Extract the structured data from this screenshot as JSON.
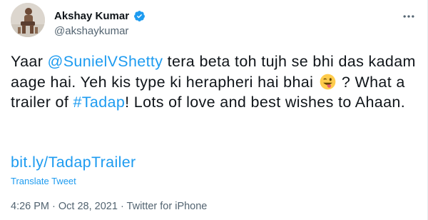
{
  "user": {
    "name": "Akshay Kumar",
    "handle": "@akshaykumar"
  },
  "tweet": {
    "line1_prefix": "Yaar ",
    "mention": "@SunielVShetty",
    "line1_rest": " tera beta toh tujh se bhi das kadam aage hai. Yeh kis type ki herapheri hai bhai ",
    "after_emoji": " ? What a trailer of ",
    "hashtag": "#Tadap",
    "ending": "! Lots of love and best wishes to Ahaan.",
    "link": "bit.ly/TadapTrailer",
    "translate": "Translate Tweet"
  },
  "meta": {
    "time": "4:26 PM",
    "sep1": " · ",
    "date": "Oct 28, 2021",
    "sep2": " · ",
    "source": "Twitter for iPhone"
  },
  "colors": {
    "link": "#1d9bf0",
    "secondary_text": "#536471",
    "verified": "#1d9bf0"
  },
  "icons": [
    "verified-badge-icon",
    "more-options-icon",
    "winking-tongue-emoji-icon"
  ]
}
